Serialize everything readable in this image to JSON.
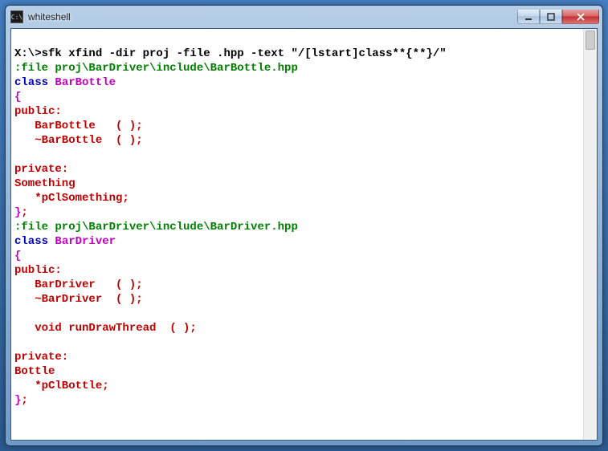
{
  "window": {
    "title": "whiteshell",
    "icon_label": "C:\\"
  },
  "prompt": {
    "path": "X:\\>",
    "command": "sfk xfind -dir proj -file .hpp -text \"/[lstart]class**{**}/\""
  },
  "output": [
    {
      "type": "file",
      "text": ":file proj\\BarDriver\\include\\BarBottle.hpp"
    },
    {
      "type": "code",
      "segments": [
        {
          "c": "blue",
          "t": "class "
        },
        {
          "c": "magenta",
          "t": "BarBottle"
        }
      ]
    },
    {
      "type": "code",
      "segments": [
        {
          "c": "magenta",
          "t": "{"
        }
      ]
    },
    {
      "type": "code",
      "segments": [
        {
          "c": "red",
          "t": "public:"
        }
      ]
    },
    {
      "type": "code",
      "segments": [
        {
          "c": "red",
          "t": "   BarBottle   ( );"
        }
      ]
    },
    {
      "type": "code",
      "segments": [
        {
          "c": "red",
          "t": "   ~BarBottle  ( );"
        }
      ]
    },
    {
      "type": "blank"
    },
    {
      "type": "code",
      "segments": [
        {
          "c": "red",
          "t": "private:"
        }
      ]
    },
    {
      "type": "code",
      "segments": [
        {
          "c": "red",
          "t": "Something"
        }
      ]
    },
    {
      "type": "code",
      "segments": [
        {
          "c": "red",
          "t": "   *pClSomething;"
        }
      ]
    },
    {
      "type": "code",
      "segments": [
        {
          "c": "magenta",
          "t": "}"
        },
        {
          "c": "red",
          "t": ";"
        }
      ]
    },
    {
      "type": "file",
      "text": ":file proj\\BarDriver\\include\\BarDriver.hpp"
    },
    {
      "type": "code",
      "segments": [
        {
          "c": "blue",
          "t": "class "
        },
        {
          "c": "magenta",
          "t": "BarDriver"
        }
      ]
    },
    {
      "type": "code",
      "segments": [
        {
          "c": "magenta",
          "t": "{"
        }
      ]
    },
    {
      "type": "code",
      "segments": [
        {
          "c": "red",
          "t": "public:"
        }
      ]
    },
    {
      "type": "code",
      "segments": [
        {
          "c": "red",
          "t": "   BarDriver   ( );"
        }
      ]
    },
    {
      "type": "code",
      "segments": [
        {
          "c": "red",
          "t": "   ~BarDriver  ( );"
        }
      ]
    },
    {
      "type": "blank"
    },
    {
      "type": "code",
      "segments": [
        {
          "c": "red",
          "t": "   void runDrawThread  ( );"
        }
      ]
    },
    {
      "type": "blank"
    },
    {
      "type": "code",
      "segments": [
        {
          "c": "red",
          "t": "private:"
        }
      ]
    },
    {
      "type": "code",
      "segments": [
        {
          "c": "red",
          "t": "Bottle"
        }
      ]
    },
    {
      "type": "code",
      "segments": [
        {
          "c": "red",
          "t": "   *pClBottle;"
        }
      ]
    },
    {
      "type": "code",
      "segments": [
        {
          "c": "magenta",
          "t": "}"
        },
        {
          "c": "red",
          "t": ";"
        }
      ]
    }
  ]
}
